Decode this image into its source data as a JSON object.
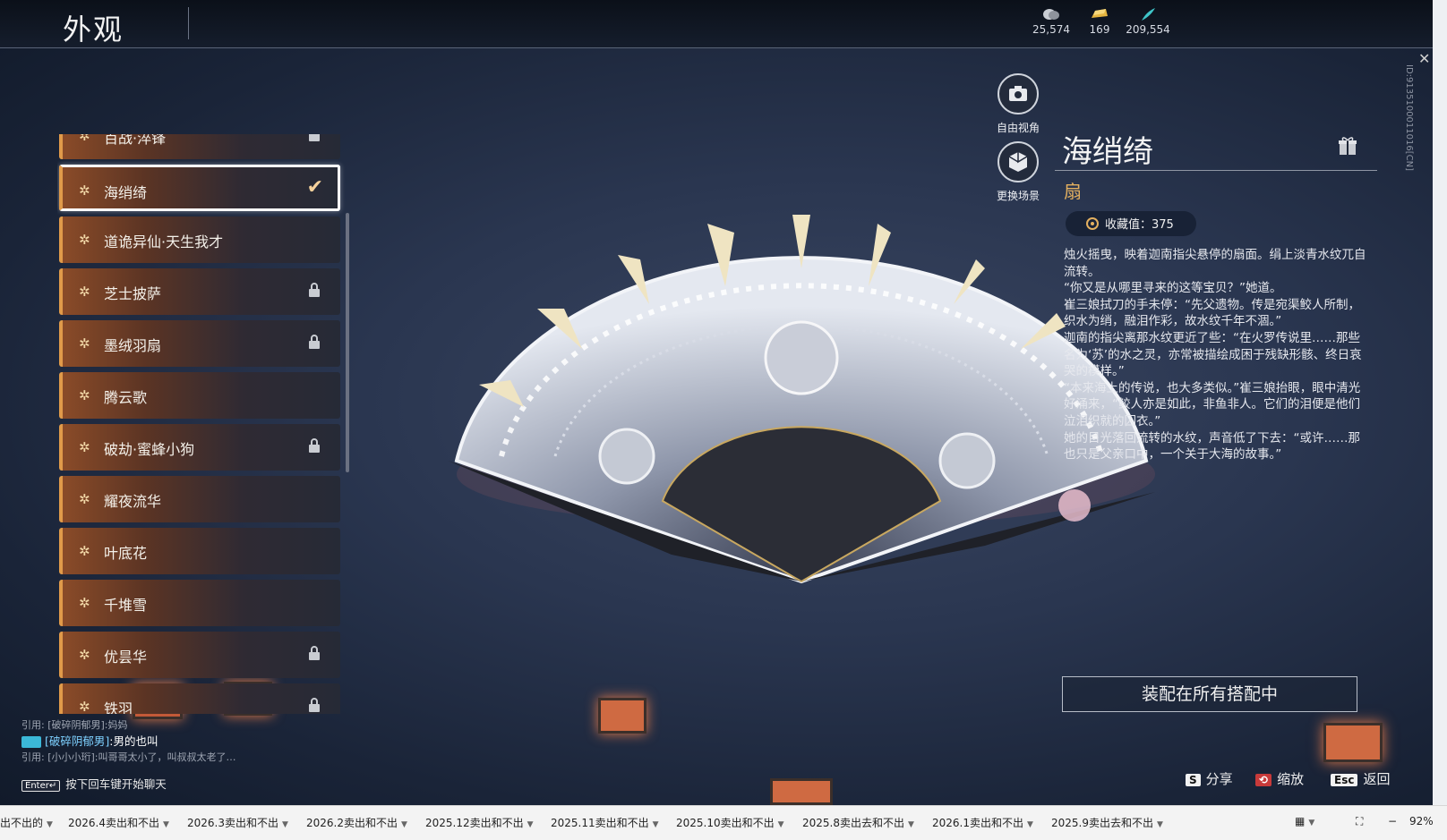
{
  "header": {
    "title": "外观",
    "currencies": [
      {
        "icon": "coin-stack-icon",
        "value": "25,574"
      },
      {
        "icon": "gold-ingot-icon",
        "value": "169"
      },
      {
        "icon": "jade-feather-icon",
        "value": "209,554"
      }
    ]
  },
  "list": {
    "items": [
      {
        "name": "百战·淬锋",
        "locked": true,
        "selected": false
      },
      {
        "name": "海绡绮",
        "locked": false,
        "selected": true
      },
      {
        "name": "道诡异仙·天生我才",
        "locked": false,
        "selected": false
      },
      {
        "name": "芝士披萨",
        "locked": true,
        "selected": false
      },
      {
        "name": "墨绒羽扇",
        "locked": true,
        "selected": false
      },
      {
        "name": "腾云歌",
        "locked": false,
        "selected": false
      },
      {
        "name": "破劫·蜜蜂小狗",
        "locked": true,
        "selected": false
      },
      {
        "name": "耀夜流华",
        "locked": false,
        "selected": false
      },
      {
        "name": "叶底花",
        "locked": false,
        "selected": false
      },
      {
        "name": "千堆雪",
        "locked": false,
        "selected": false
      },
      {
        "name": "优昙华",
        "locked": true,
        "selected": false
      },
      {
        "name": "铁羽",
        "locked": true,
        "selected": false
      }
    ]
  },
  "side_buttons": {
    "free_view": "自由视角",
    "change_scene": "更换场景"
  },
  "detail": {
    "title": "海绡绮",
    "type": "扇",
    "collect_label": "收藏值：375",
    "description": [
      "烛火摇曳，映着迦南指尖悬停的扇面。绢上淡青水纹兀自流转。",
      "“你又是从哪里寻来的这等宝贝？”她道。",
      "崔三娘拭刀的手未停：“先父遗物。传是宛渠鲛人所制，织水为绡，融泪作彩，故水纹千年不涸。”",
      "迦南的指尖离那水纹更近了些：“在火罗传说里……那些名为‘苏’的水之灵，亦常被描绘成困于残缺形骸、终日哀哭的模样。”",
      "“本来海上的传说，也大多类似。”崔三娘抬眼，眼中清光好涌来，“鲛人亦是如此，非鱼非人。它们的泪便是他们泣泪织就的囚衣。”",
      "她的目光落回流转的水纹，声音低了下去：“或许……那也只是父亲口中，一个关于大海的故事。”"
    ],
    "equip_button": "装配在所有搭配中"
  },
  "vertical_id": "ID:9135100011016[CN]",
  "chat": {
    "lines": [
      {
        "prefix": "引用: ",
        "who": "[破碎阴郁男]",
        "text": ":妈妈"
      },
      {
        "prefix": "",
        "who": "[破碎阴郁男]",
        "text": ":男的也叫"
      },
      {
        "prefix": "引用: ",
        "who": "[小小小珩]",
        "text": ":叫哥哥太小了，叫叔叔太老了…"
      }
    ],
    "enter_key": "Enter↵",
    "hint": "按下回车键开始聊天"
  },
  "key_hints": [
    {
      "key": "S",
      "label": "分享"
    },
    {
      "key": "⟲",
      "label": "缩放"
    },
    {
      "key": "Esc",
      "label": "返回"
    }
  ],
  "bottom_tabs": [
    "出不出的",
    "2026.4卖出和不出",
    "2026.3卖出和不出",
    "2026.2卖出和不出",
    "2025.12卖出和不出",
    "2025.11卖出和不出",
    "2025.10卖出和不出",
    "2025.8卖出去和不出",
    "2026.1卖出和不出",
    "2025.9卖出去和不出"
  ],
  "zoom": "92%",
  "colors": {
    "accent_orange": "#e09a4a",
    "gold_text": "#e3b060",
    "background": "#2a3650"
  }
}
